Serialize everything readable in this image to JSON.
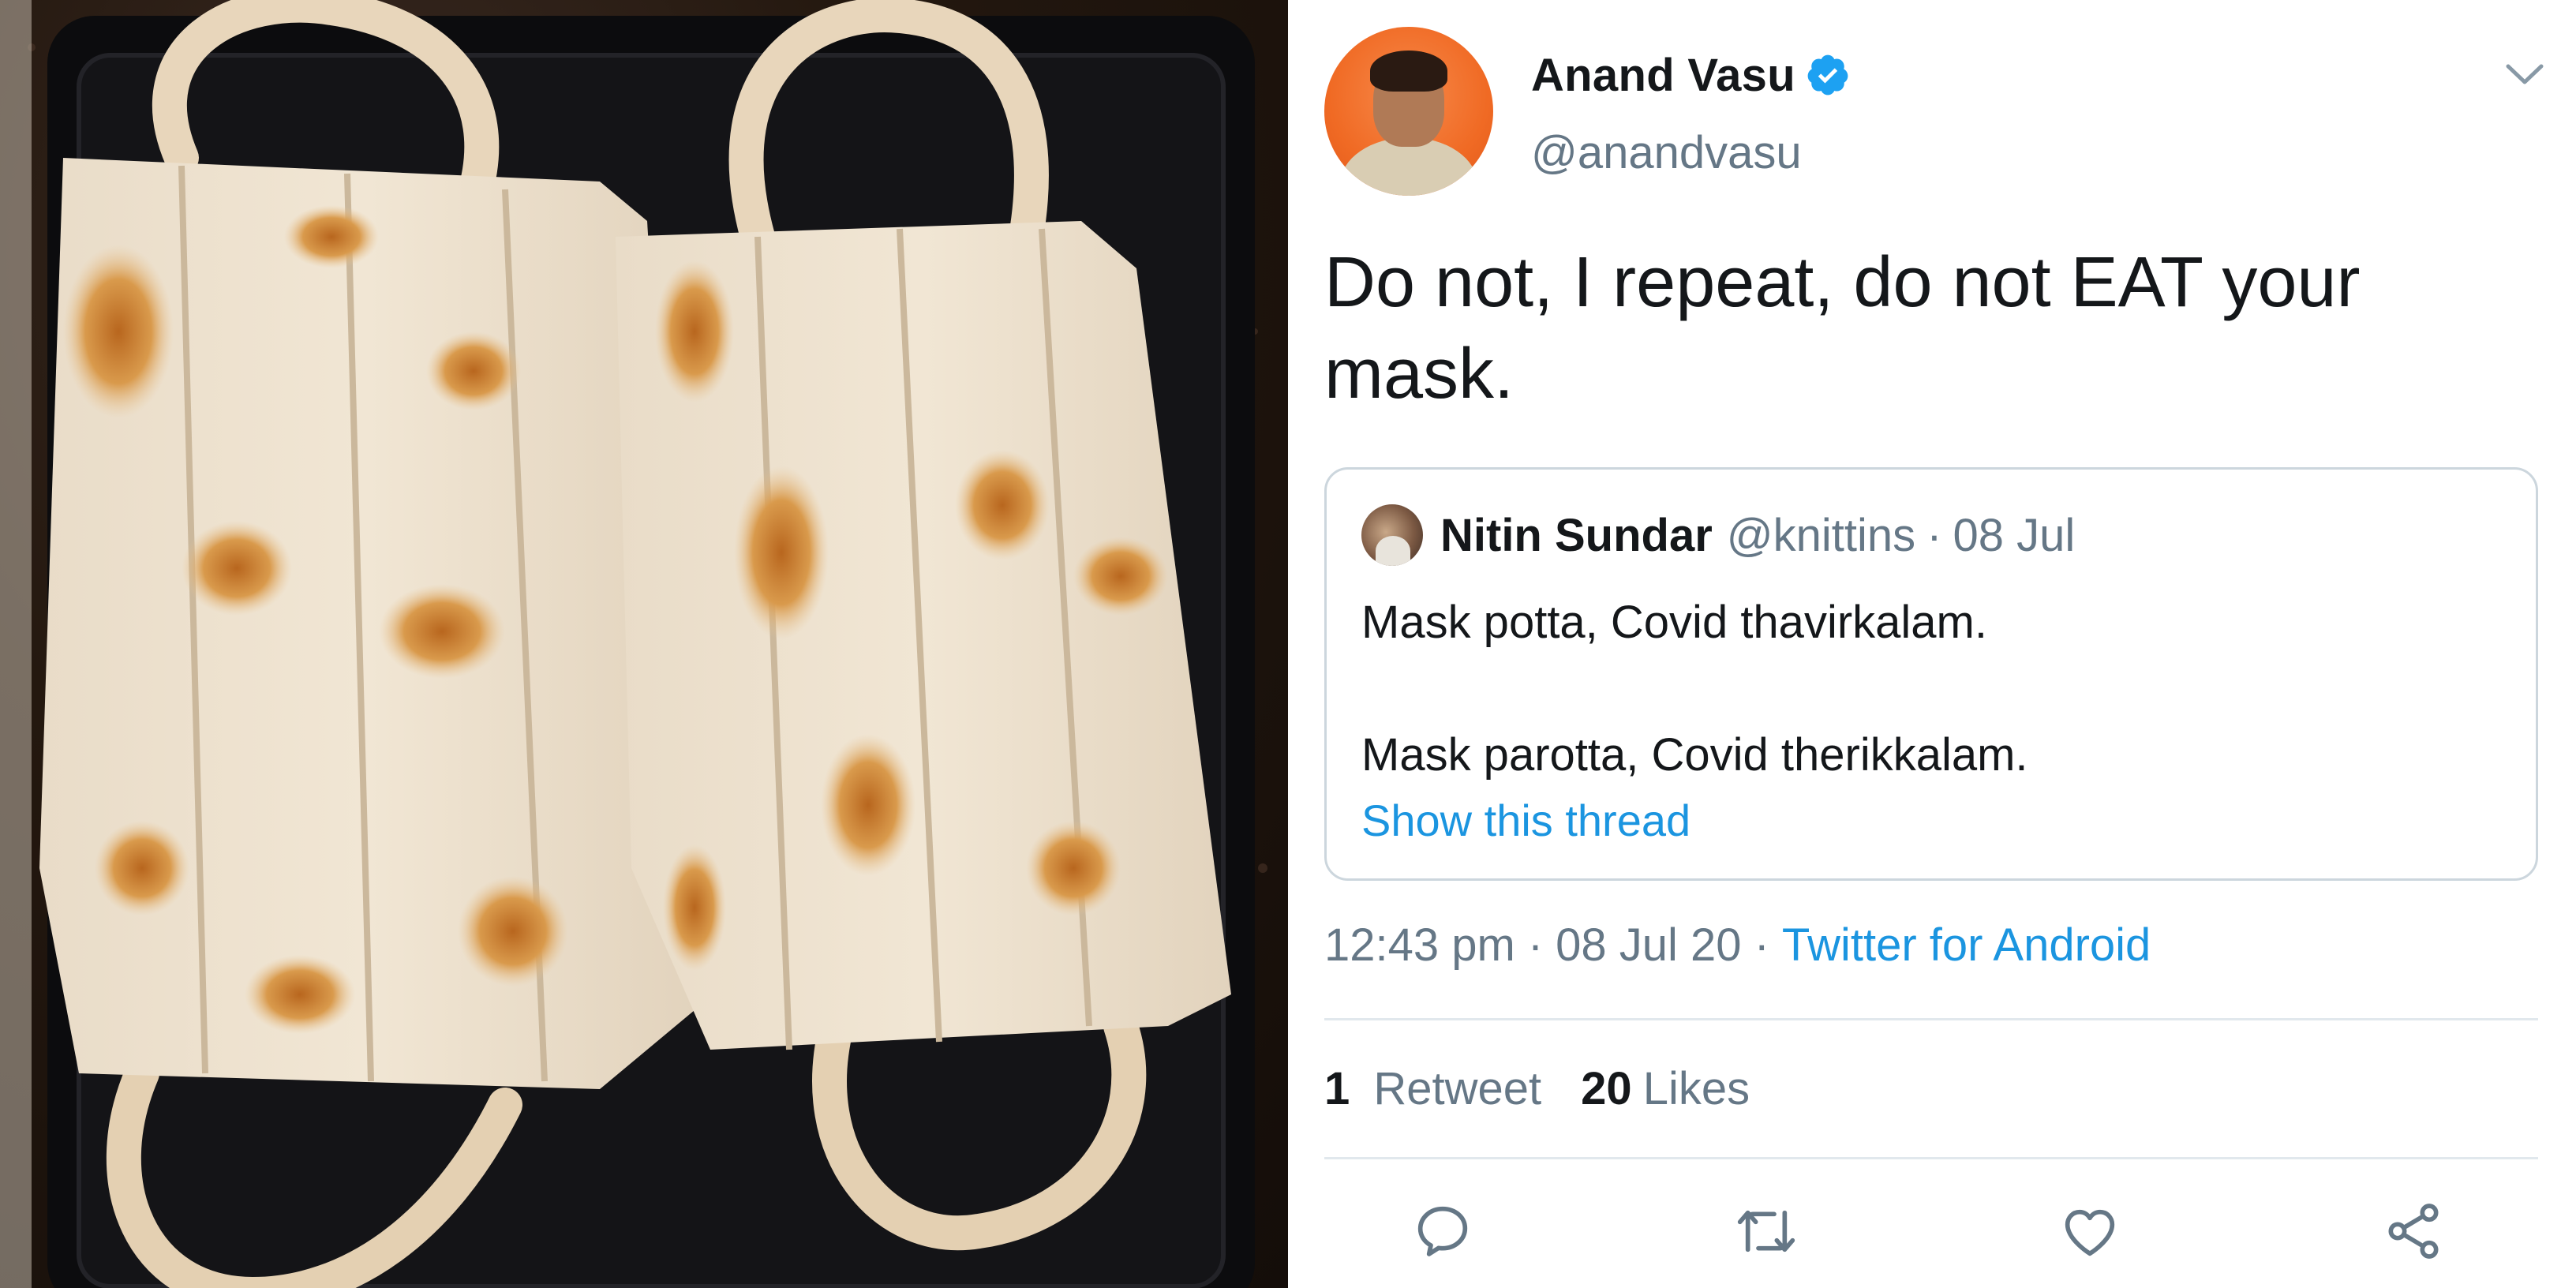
{
  "tweet": {
    "author": {
      "display_name": "Anand Vasu",
      "handle": "@anandvasu",
      "verified": true
    },
    "text": "Do not, I repeat, do not EAT your mask.",
    "quoted_tweet": {
      "author_name": "Nitin Sundar",
      "author_handle": "@knittins",
      "separator": "·",
      "date": "08 Jul",
      "line1": "Mask potta, Covid thavirkalam.",
      "line2": "Mask parotta, Covid therikkalam.",
      "show_thread_label": "Show this thread"
    },
    "meta": {
      "time": "12:43 pm",
      "separator": "·",
      "date": "08 Jul 20",
      "source": "Twitter for Android"
    },
    "stats": {
      "retweets_count": "1",
      "retweets_label": "Retweet",
      "likes_count": "20",
      "likes_label": "Likes"
    },
    "actions": [
      "reply-icon",
      "retweet-icon",
      "like-icon",
      "share-icon"
    ]
  },
  "colors": {
    "verified": "#1da1f2",
    "link": "#1b95e0",
    "secondary_text": "#657786",
    "border": "#ccd6dd",
    "avatar_bg": "#f06a24"
  },
  "photo": {
    "subject": "two parottas shaped like face masks on a dark baking tray"
  }
}
